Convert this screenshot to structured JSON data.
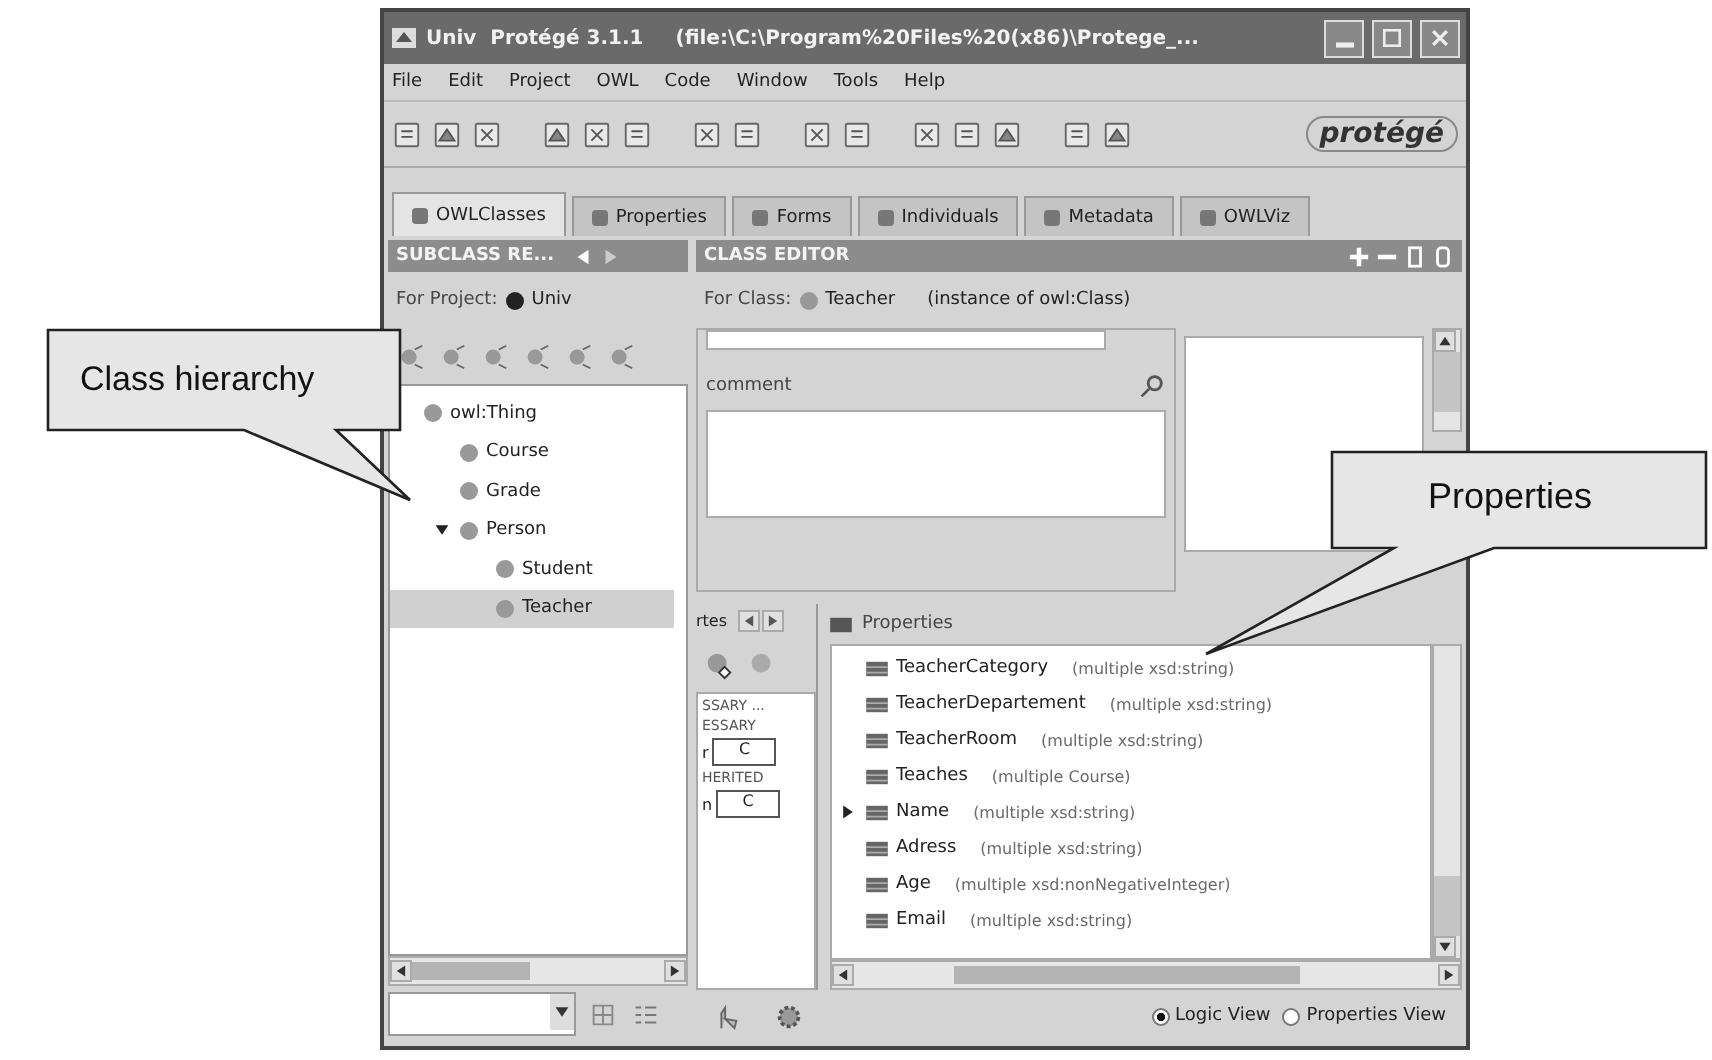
{
  "window": {
    "title": "Univ  Protégé 3.1.1",
    "path": "(file:\\C:\\Program%20Files%20(x86)\\Protege_..."
  },
  "menu": [
    "File",
    "Edit",
    "Project",
    "OWL",
    "Code",
    "Window",
    "Tools",
    "Help"
  ],
  "logo": "protégé",
  "tabs": [
    {
      "label": "OWLClasses",
      "selected": true
    },
    {
      "label": "Properties",
      "selected": false
    },
    {
      "label": "Forms",
      "selected": false
    },
    {
      "label": "Individuals",
      "selected": false
    },
    {
      "label": "Metadata",
      "selected": false
    },
    {
      "label": "OWLViz",
      "selected": false
    }
  ],
  "subclass_panel": {
    "title": "SUBCLASS RE...",
    "project_label": "For Project:",
    "project": "Univ",
    "tree": [
      {
        "label": "owl:Thing",
        "selected": false,
        "children": [
          {
            "label": "Course",
            "selected": false
          },
          {
            "label": "Grade",
            "selected": false
          },
          {
            "label": "Person",
            "selected": false,
            "expanded": true,
            "children": [
              {
                "label": "Student",
                "selected": false
              },
              {
                "label": "Teacher",
                "selected": true
              }
            ]
          }
        ]
      }
    ]
  },
  "class_editor": {
    "title": "CLASS EDITOR",
    "class_label": "For Class:",
    "class_name": "Teacher",
    "class_type": "(instance of owl:Class)",
    "comment_label": "comment",
    "side_tab": "rtes",
    "side_items": [
      {
        "kind": "label",
        "text": "SSARY ..."
      },
      {
        "kind": "label",
        "text": "ESSARY"
      },
      {
        "kind": "field",
        "prefix": "r",
        "value": "C"
      },
      {
        "kind": "label",
        "text": "HERITED"
      },
      {
        "kind": "field",
        "prefix": "n",
        "value": "C"
      }
    ],
    "properties_title": "Properties",
    "properties": [
      {
        "name": "TeacherCategory",
        "range": "(multiple xsd:string)"
      },
      {
        "name": "TeacherDepartement",
        "range": "(multiple xsd:string)"
      },
      {
        "name": "TeacherRoom",
        "range": "(multiple xsd:string)"
      },
      {
        "name": "Teaches",
        "range": "(multiple Course)"
      },
      {
        "name": "Name",
        "range": "(multiple xsd:string)",
        "expanded": false
      },
      {
        "name": "Adress",
        "range": "(multiple xsd:string)"
      },
      {
        "name": "Age",
        "range": "(multiple xsd:nonNegativeInteger)"
      },
      {
        "name": "Email",
        "range": "(multiple xsd:string)"
      }
    ],
    "views": [
      {
        "label": "Logic View",
        "selected": true
      },
      {
        "label": "Properties View",
        "selected": false
      }
    ]
  },
  "callouts": [
    {
      "text": "Class hierarchy"
    },
    {
      "text": "Properties"
    }
  ]
}
